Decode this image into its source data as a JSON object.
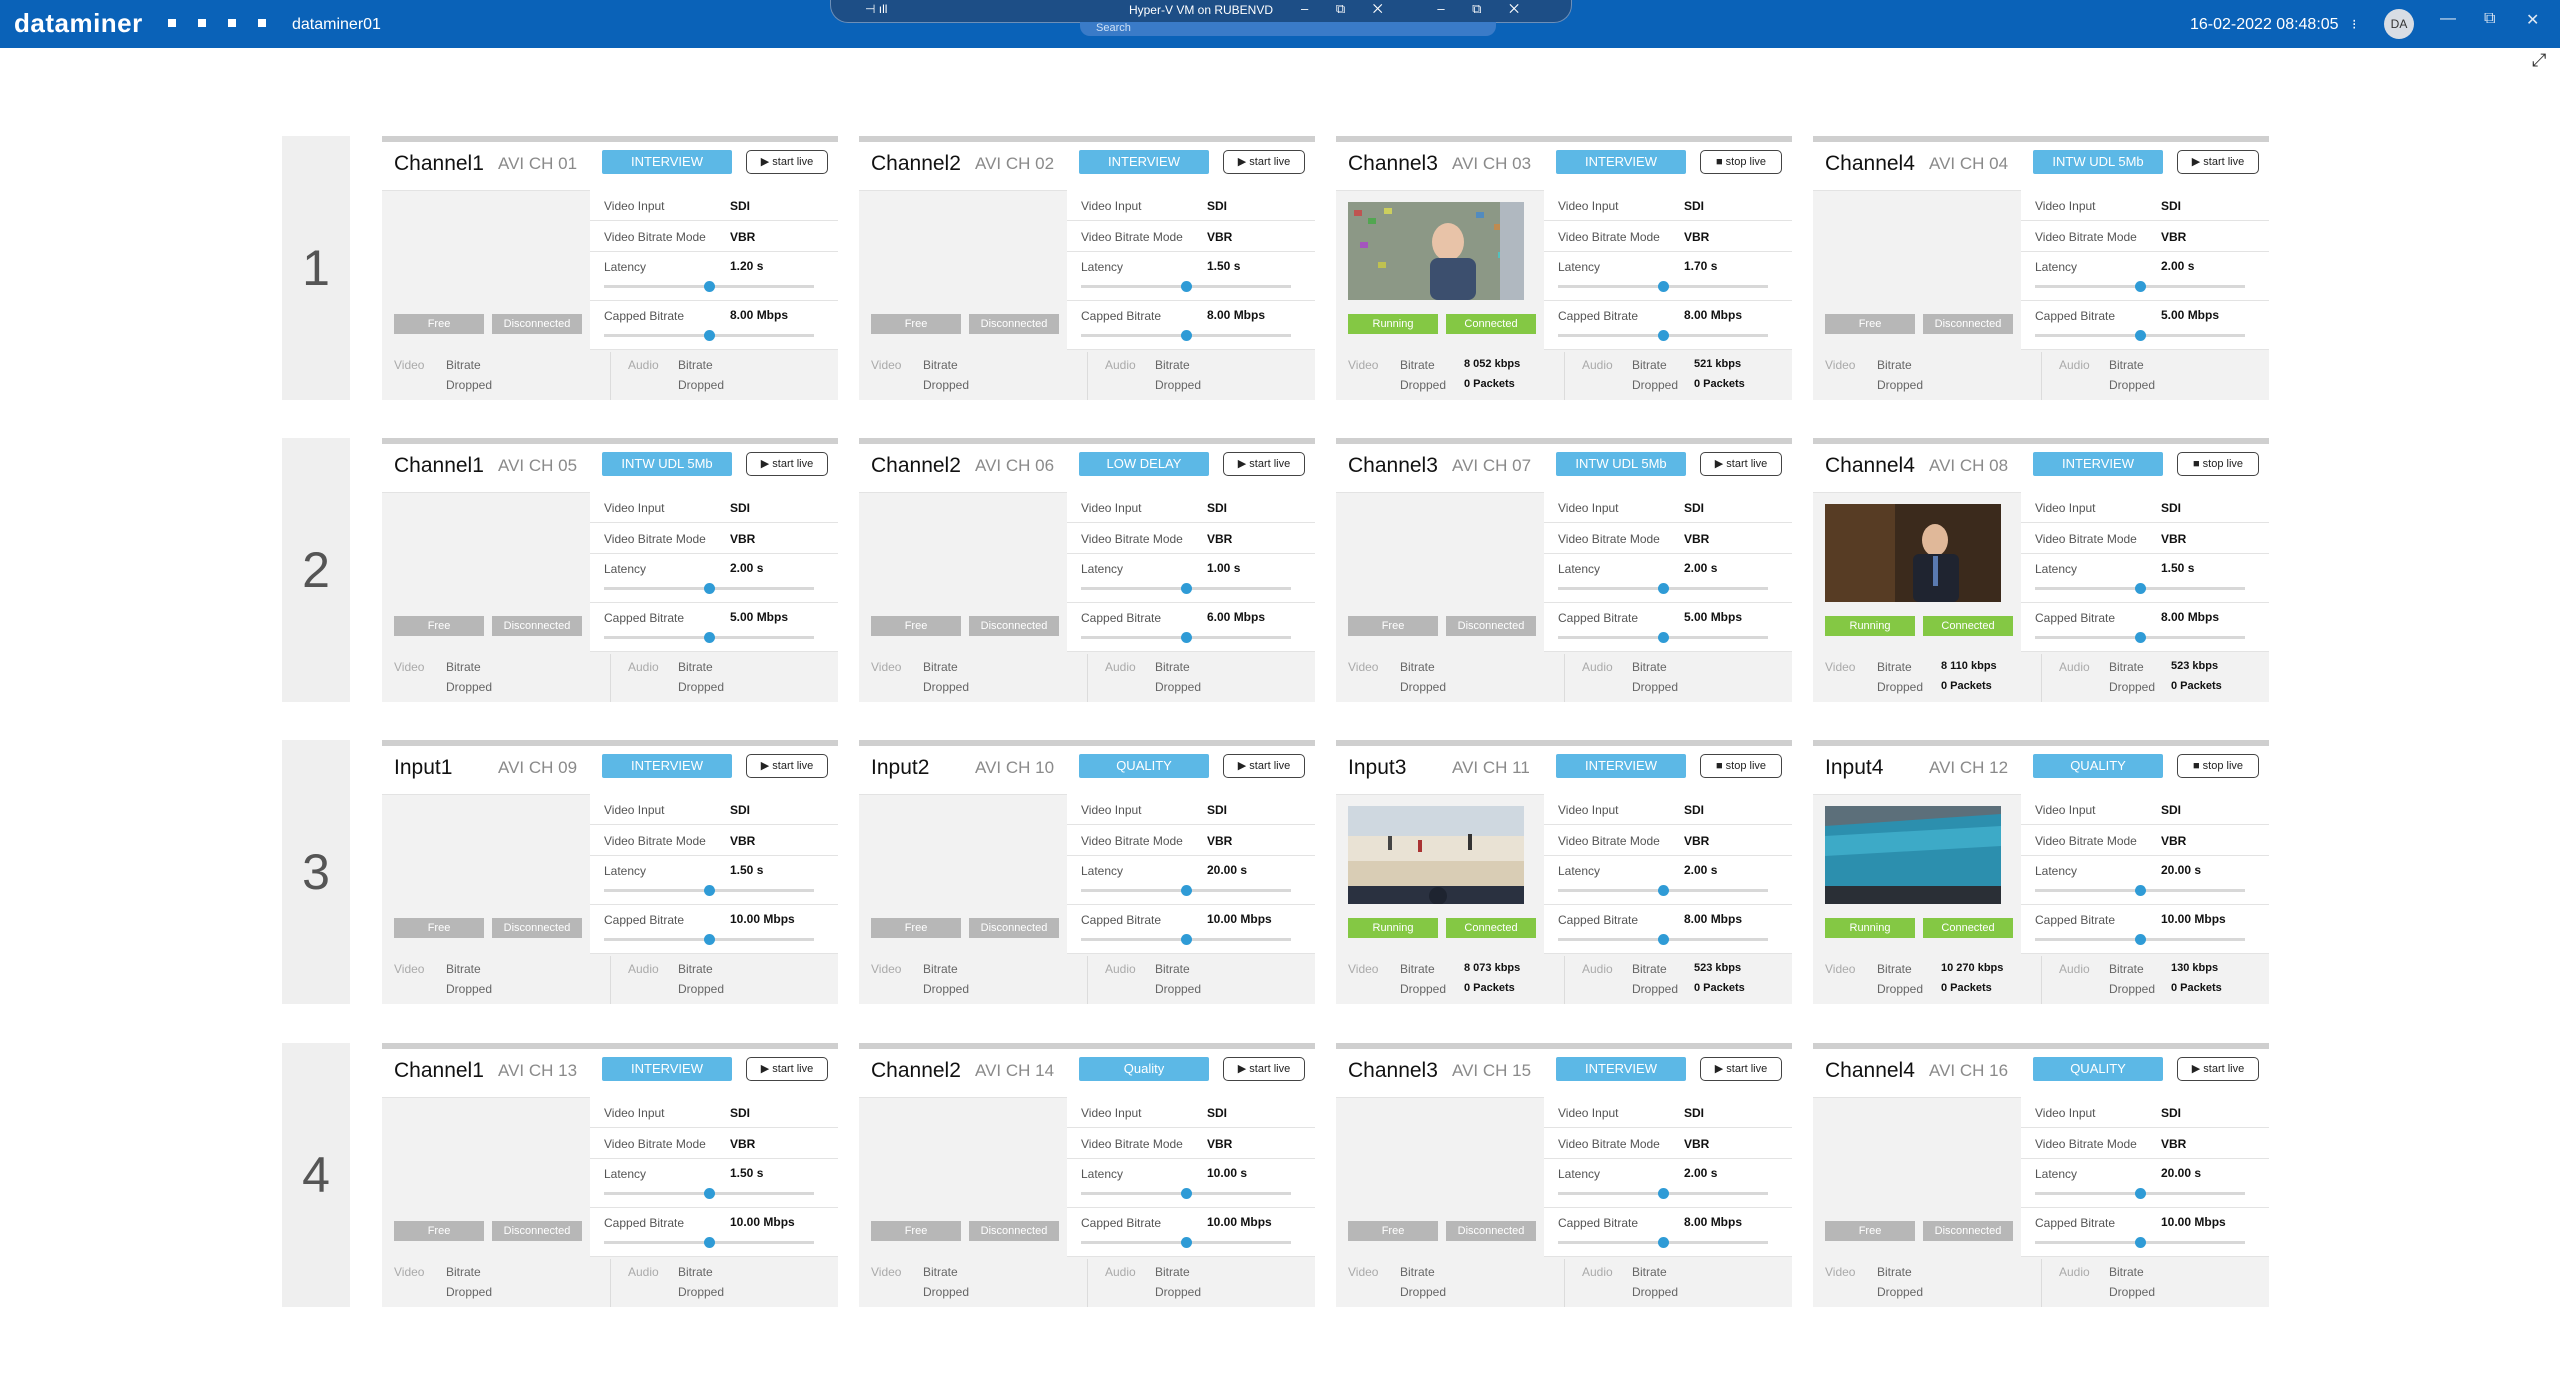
{
  "topbar": {
    "logo": "dataminer",
    "host": "dataminer01",
    "vm_title": "Hyper-V VM on RUBENVD",
    "search_placeholder": "Search",
    "datetime": "16-02-2022 08:48:05",
    "extra": "⁝",
    "avatar": "DA",
    "icons": [
      "pin-icon",
      "signal-icon",
      "minimize-icon",
      "restore-icon",
      "close-icon",
      "window-minimize-icon",
      "window-restore-icon",
      "window-close-icon",
      "expand-icon"
    ]
  },
  "colors": {
    "accent": "#0a62b8",
    "mode": "#5cb8e6",
    "running": "#84c844",
    "inactive": "#b7b7b7",
    "slider": "#2f9bd6"
  },
  "labels": {
    "video_input": "Video Input",
    "bitrate_mode": "Video Bitrate Mode",
    "latency": "Latency",
    "capped_bitrate": "Capped Bitrate",
    "video": "Video",
    "audio": "Audio",
    "bitrate": "Bitrate",
    "dropped": "Dropped"
  },
  "rows": [
    {
      "num": "1",
      "cards": [
        {
          "name": "Channel1",
          "ch": "AVI CH 01",
          "mode": "INTERVIEW",
          "action": "▶ start live",
          "s1": "Free",
          "s2": "Disconnected",
          "running": false,
          "input": "SDI",
          "bmode": "VBR",
          "latency": "1.20 s",
          "lat_frac": 0.5,
          "capped": "8.00 Mbps",
          "cap_frac": 0.5,
          "vbit": "",
          "vdrop": "",
          "abit": "",
          "adrop": "",
          "thumb": ""
        },
        {
          "name": "Channel2",
          "ch": "AVI CH 02",
          "mode": "INTERVIEW",
          "action": "▶ start live",
          "s1": "Free",
          "s2": "Disconnected",
          "running": false,
          "input": "SDI",
          "bmode": "VBR",
          "latency": "1.50 s",
          "lat_frac": 0.5,
          "capped": "8.00 Mbps",
          "cap_frac": 0.5,
          "vbit": "",
          "vdrop": "",
          "abit": "",
          "adrop": "",
          "thumb": ""
        },
        {
          "name": "Channel3",
          "ch": "AVI CH 03",
          "mode": "INTERVIEW",
          "action": "■ stop live",
          "s1": "Running",
          "s2": "Connected",
          "running": true,
          "input": "SDI",
          "bmode": "VBR",
          "latency": "1.70 s",
          "lat_frac": 0.5,
          "capped": "8.00 Mbps",
          "cap_frac": 0.5,
          "vbit": "8 052 kbps",
          "vdrop": "0 Packets",
          "abit": "521 kbps",
          "adrop": "0 Packets",
          "thumb": "presenter"
        },
        {
          "name": "Channel4",
          "ch": "AVI CH 04",
          "mode": "INTW UDL 5Mb",
          "action": "▶ start live",
          "s1": "Free",
          "s2": "Disconnected",
          "running": false,
          "input": "SDI",
          "bmode": "VBR",
          "latency": "2.00 s",
          "lat_frac": 0.5,
          "capped": "5.00 Mbps",
          "cap_frac": 0.5,
          "vbit": "",
          "vdrop": "",
          "abit": "",
          "adrop": "",
          "thumb": ""
        }
      ]
    },
    {
      "num": "2",
      "cards": [
        {
          "name": "Channel1",
          "ch": "AVI CH 05",
          "mode": "INTW UDL 5Mb",
          "action": "▶ start live",
          "s1": "Free",
          "s2": "Disconnected",
          "running": false,
          "input": "SDI",
          "bmode": "VBR",
          "latency": "2.00 s",
          "lat_frac": 0.5,
          "capped": "5.00 Mbps",
          "cap_frac": 0.5,
          "vbit": "",
          "vdrop": "",
          "abit": "",
          "adrop": "",
          "thumb": ""
        },
        {
          "name": "Channel2",
          "ch": "AVI CH 06",
          "mode": "LOW DELAY",
          "action": "▶ start live",
          "s1": "Free",
          "s2": "Disconnected",
          "running": false,
          "input": "SDI",
          "bmode": "VBR",
          "latency": "1.00 s",
          "lat_frac": 0.5,
          "capped": "6.00 Mbps",
          "cap_frac": 0.5,
          "vbit": "",
          "vdrop": "",
          "abit": "",
          "adrop": "",
          "thumb": ""
        },
        {
          "name": "Channel3",
          "ch": "AVI CH 07",
          "mode": "INTW UDL 5Mb",
          "action": "▶ start live",
          "s1": "Free",
          "s2": "Disconnected",
          "running": false,
          "input": "SDI",
          "bmode": "VBR",
          "latency": "2.00 s",
          "lat_frac": 0.5,
          "capped": "5.00 Mbps",
          "cap_frac": 0.5,
          "vbit": "",
          "vdrop": "",
          "abit": "",
          "adrop": "",
          "thumb": ""
        },
        {
          "name": "Channel4",
          "ch": "AVI CH 08",
          "mode": "INTERVIEW",
          "action": "■ stop live",
          "s1": "Running",
          "s2": "Connected",
          "running": true,
          "input": "SDI",
          "bmode": "VBR",
          "latency": "1.50 s",
          "lat_frac": 0.5,
          "capped": "8.00 Mbps",
          "cap_frac": 0.5,
          "vbit": "8 110 kbps",
          "vdrop": "0 Packets",
          "abit": "523 kbps",
          "adrop": "0 Packets",
          "thumb": "anchor"
        }
      ]
    },
    {
      "num": "3",
      "cards": [
        {
          "name": "Input1",
          "ch": "AVI CH 09",
          "mode": "INTERVIEW",
          "action": "▶ start live",
          "s1": "Free",
          "s2": "Disconnected",
          "running": false,
          "input": "SDI",
          "bmode": "VBR",
          "latency": "1.50 s",
          "lat_frac": 0.5,
          "capped": "10.00 Mbps",
          "cap_frac": 0.5,
          "vbit": "",
          "vdrop": "",
          "abit": "",
          "adrop": "",
          "thumb": ""
        },
        {
          "name": "Input2",
          "ch": "AVI CH 10",
          "mode": "QUALITY",
          "action": "▶ start live",
          "s1": "Free",
          "s2": "Disconnected",
          "running": false,
          "input": "SDI",
          "bmode": "VBR",
          "latency": "20.00 s",
          "lat_frac": 0.5,
          "capped": "10.00 Mbps",
          "cap_frac": 0.5,
          "vbit": "",
          "vdrop": "",
          "abit": "",
          "adrop": "",
          "thumb": ""
        },
        {
          "name": "Input3",
          "ch": "AVI CH 11",
          "mode": "INTERVIEW",
          "action": "■ stop live",
          "s1": "Running",
          "s2": "Connected",
          "running": true,
          "input": "SDI",
          "bmode": "VBR",
          "latency": "2.00 s",
          "lat_frac": 0.5,
          "capped": "8.00 Mbps",
          "cap_frac": 0.5,
          "vbit": "8 073 kbps",
          "vdrop": "0 Packets",
          "abit": "523 kbps",
          "adrop": "0 Packets",
          "thumb": "beach"
        },
        {
          "name": "Input4",
          "ch": "AVI CH 12",
          "mode": "QUALITY",
          "action": "■ stop live",
          "s1": "Running",
          "s2": "Connected",
          "running": true,
          "input": "SDI",
          "bmode": "VBR",
          "latency": "20.00 s",
          "lat_frac": 0.5,
          "capped": "10.00 Mbps",
          "cap_frac": 0.5,
          "vbit": "10 270 kbps",
          "vdrop": "0 Packets",
          "abit": "130 kbps",
          "adrop": "0 Packets",
          "thumb": "aquarium"
        }
      ]
    },
    {
      "num": "4",
      "cards": [
        {
          "name": "Channel1",
          "ch": "AVI CH 13",
          "mode": "INTERVIEW",
          "action": "▶ start live",
          "s1": "Free",
          "s2": "Disconnected",
          "running": false,
          "input": "SDI",
          "bmode": "VBR",
          "latency": "1.50 s",
          "lat_frac": 0.5,
          "capped": "10.00 Mbps",
          "cap_frac": 0.5,
          "vbit": "",
          "vdrop": "",
          "abit": "",
          "adrop": "",
          "thumb": ""
        },
        {
          "name": "Channel2",
          "ch": "AVI CH 14",
          "mode": "Quality",
          "action": "▶ start live",
          "s1": "Free",
          "s2": "Disconnected",
          "running": false,
          "input": "SDI",
          "bmode": "VBR",
          "latency": "10.00 s",
          "lat_frac": 0.5,
          "capped": "10.00 Mbps",
          "cap_frac": 0.5,
          "vbit": "",
          "vdrop": "",
          "abit": "",
          "adrop": "",
          "thumb": ""
        },
        {
          "name": "Channel3",
          "ch": "AVI CH 15",
          "mode": "INTERVIEW",
          "action": "▶ start live",
          "s1": "Free",
          "s2": "Disconnected",
          "running": false,
          "input": "SDI",
          "bmode": "VBR",
          "latency": "2.00 s",
          "lat_frac": 0.5,
          "capped": "8.00 Mbps",
          "cap_frac": 0.5,
          "vbit": "",
          "vdrop": "",
          "abit": "",
          "adrop": "",
          "thumb": ""
        },
        {
          "name": "Channel4",
          "ch": "AVI CH 16",
          "mode": "QUALITY",
          "action": "▶ start live",
          "s1": "Free",
          "s2": "Disconnected",
          "running": false,
          "input": "SDI",
          "bmode": "VBR",
          "latency": "20.00 s",
          "lat_frac": 0.5,
          "capped": "10.00 Mbps",
          "cap_frac": 0.5,
          "vbit": "",
          "vdrop": "",
          "abit": "",
          "adrop": "",
          "thumb": ""
        }
      ]
    }
  ]
}
